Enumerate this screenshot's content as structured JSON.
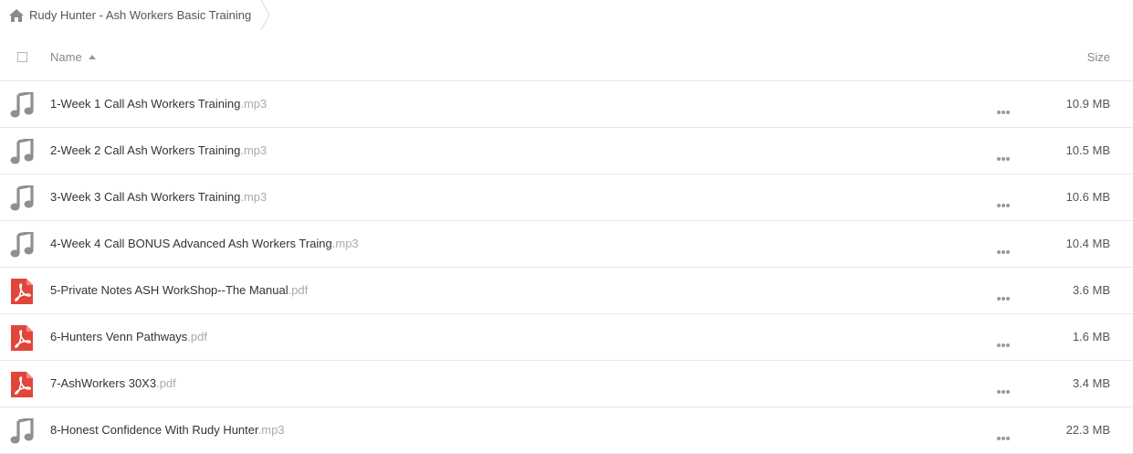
{
  "breadcrumb": {
    "icon": "home-icon",
    "folder": "Rudy Hunter - Ash Workers Basic Training"
  },
  "header": {
    "name_label": "Name",
    "size_label": "Size",
    "sort": "ascending"
  },
  "colors": {
    "music_icon": "#8f8f8f",
    "pdf_icon": "#e2453b",
    "extension_text": "#aaaaaa",
    "divider": "#e8e8e8"
  },
  "files": [
    {
      "name": "1-Week 1 Call Ash Workers Training",
      "ext": ".mp3",
      "size": "10.9 MB",
      "icon": "music-note-icon"
    },
    {
      "name": "2-Week 2 Call Ash Workers Training",
      "ext": ".mp3",
      "size": "10.5 MB",
      "icon": "music-note-icon"
    },
    {
      "name": "3-Week 3 Call Ash Workers Training",
      "ext": ".mp3",
      "size": "10.6 MB",
      "icon": "music-note-icon"
    },
    {
      "name": "4-Week 4 Call BONUS Advanced Ash Workers Traing",
      "ext": ".mp3",
      "size": "10.4 MB",
      "icon": "music-note-icon"
    },
    {
      "name": "5-Private Notes ASH WorkShop--The Manual",
      "ext": ".pdf",
      "size": "3.6 MB",
      "icon": "pdf-icon"
    },
    {
      "name": "6-Hunters Venn Pathways",
      "ext": ".pdf",
      "size": "1.6 MB",
      "icon": "pdf-icon"
    },
    {
      "name": "7-AshWorkers 30X3",
      "ext": ".pdf",
      "size": "3.4 MB",
      "icon": "pdf-icon"
    },
    {
      "name": "8-Honest Confidence With Rudy Hunter",
      "ext": ".mp3",
      "size": "22.3 MB",
      "icon": "music-note-icon"
    }
  ]
}
